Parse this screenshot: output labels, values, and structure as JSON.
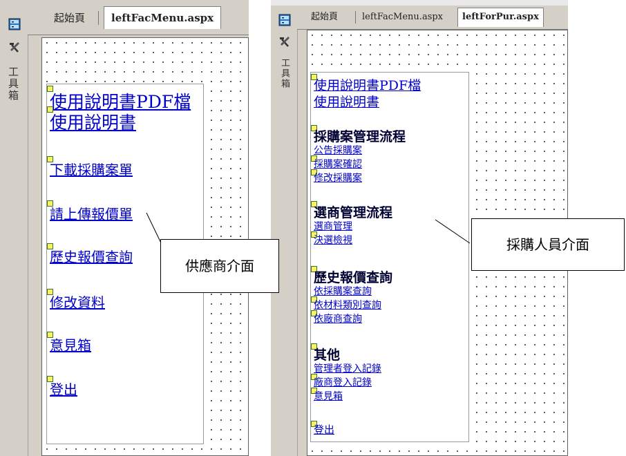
{
  "left": {
    "vertical_label": "工具箱",
    "tabs": [
      {
        "label": "起始頁",
        "active": false
      },
      {
        "label": "leftFacMenu.aspx",
        "active": true
      }
    ],
    "links": [
      {
        "text": "使用說明書PDF檔"
      },
      {
        "text": "使用說明書"
      },
      {
        "text": "下載採購案單"
      },
      {
        "text": "請上傳報價單"
      },
      {
        "text": "歷史報價查詢"
      },
      {
        "text": "修改資料"
      },
      {
        "text": "意見箱"
      },
      {
        "text": "登出"
      }
    ],
    "callout": "供應商介面"
  },
  "right": {
    "vertical_label": "工具箱",
    "tabs": [
      {
        "label": "起始頁",
        "active": false
      },
      {
        "label": "leftFacMenu.aspx",
        "active": false
      },
      {
        "label": "leftForPur.aspx",
        "active": true
      }
    ],
    "top_links": [
      {
        "text": "使用說明書PDF檔"
      },
      {
        "text": "使用說明書"
      }
    ],
    "sections": [
      {
        "heading": "採購案管理流程",
        "items": [
          "公告採購案",
          "採購案確認",
          "修改採購案"
        ]
      },
      {
        "heading": "選商管理流程",
        "items": [
          "選商管理",
          "決選檢視"
        ]
      },
      {
        "heading": "歷史報價查詢",
        "items": [
          "依採購案查詢",
          "依材料類別查詢",
          "依廠商查詢"
        ]
      },
      {
        "heading": "其他",
        "items": [
          "管理者登入記錄",
          "廠商登入記錄",
          "意見箱"
        ]
      }
    ],
    "logout": "登出",
    "callout": "採購人員介面"
  },
  "colors": {
    "link": "#0000cc",
    "heading": "#000033",
    "chrome": "#d4d0c8"
  },
  "icons": [
    "server-explorer-icon",
    "toolbox-hammer-icon",
    "component-marker-icon"
  ]
}
